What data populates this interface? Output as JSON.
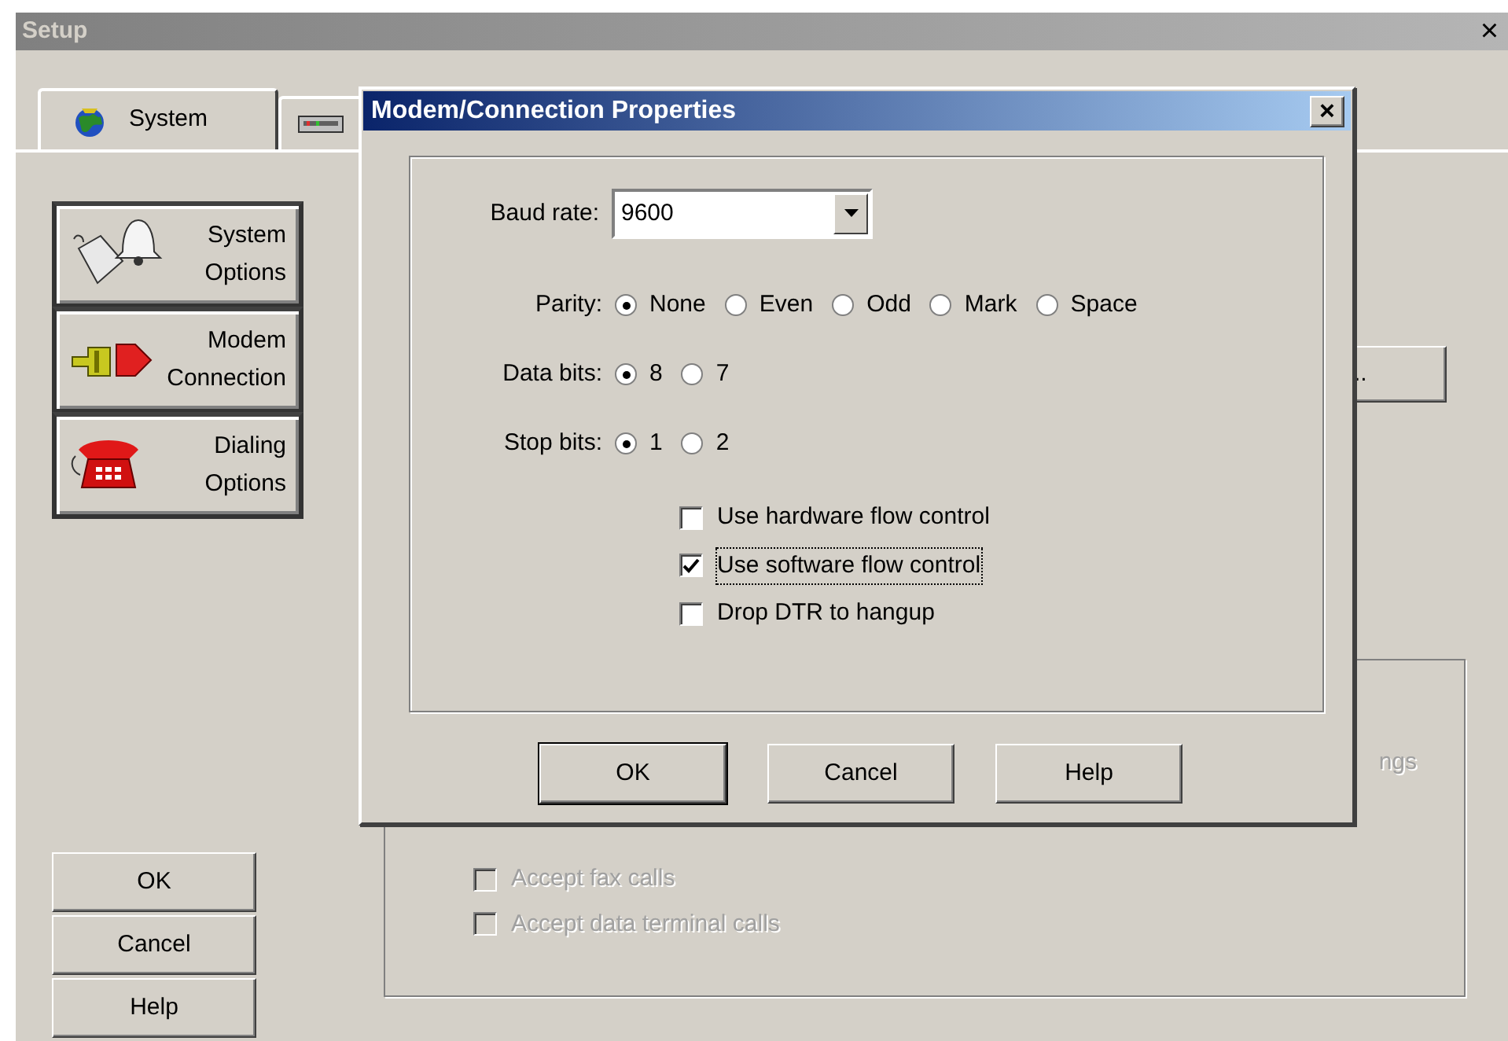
{
  "window": {
    "title": "Setup",
    "close": "×"
  },
  "tabs": [
    {
      "label": "System",
      "selected": true
    },
    {
      "selected": false
    }
  ],
  "sidebar": {
    "items": [
      {
        "label": "System Options"
      },
      {
        "label": "Modem Connection"
      },
      {
        "label": "Dialing Options"
      }
    ]
  },
  "side_button": {
    "label": ".."
  },
  "group": {
    "label": "ngs",
    "checkboxes": [
      {
        "label": "Accept fax calls",
        "checked": false,
        "disabled": true
      },
      {
        "label": "Accept data terminal calls",
        "checked": false,
        "disabled": true
      }
    ]
  },
  "buttons": [
    {
      "label": "OK",
      "default": false
    },
    {
      "label": "Cancel",
      "default": false
    },
    {
      "label": "Help",
      "default": false
    }
  ],
  "dialog": {
    "title": "Modem/Connection Properties",
    "close": "×",
    "baud": {
      "label": "Baud rate:",
      "value": "9600"
    },
    "radio_groups": [
      {
        "label": "Parity:",
        "options": [
          {
            "label": "None",
            "selected": true
          },
          {
            "label": "Even",
            "selected": false
          },
          {
            "label": "Odd",
            "selected": false
          },
          {
            "label": "Mark",
            "selected": false
          },
          {
            "label": "Space",
            "selected": false
          }
        ]
      },
      {
        "label": "Data bits:",
        "options": [
          {
            "label": "8",
            "selected": true
          },
          {
            "label": "7",
            "selected": false
          }
        ]
      },
      {
        "label": "Stop bits:",
        "options": [
          {
            "label": "1",
            "selected": true
          },
          {
            "label": "2",
            "selected": false
          }
        ]
      }
    ],
    "checkboxes": [
      {
        "label": "Use hardware flow control",
        "checked": false,
        "focused": false
      },
      {
        "label": "Use software flow control",
        "checked": true,
        "focused": true
      },
      {
        "label": "Drop DTR to hangup",
        "checked": false,
        "focused": false
      }
    ],
    "buttons": [
      {
        "label": "OK",
        "default": true
      },
      {
        "label": "Cancel",
        "default": false
      },
      {
        "label": "Help",
        "default": false
      }
    ]
  }
}
